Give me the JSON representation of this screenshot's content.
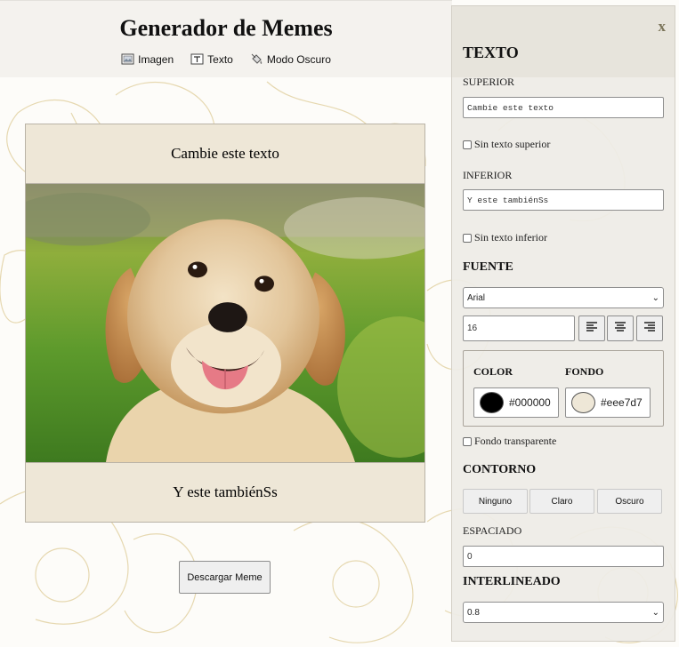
{
  "header": {
    "title": "Generador de Memes",
    "nav": [
      {
        "label": "Imagen",
        "icon": "image-icon"
      },
      {
        "label": "Texto",
        "icon": "text-icon"
      },
      {
        "label": "Modo Oscuro",
        "icon": "paint-bucket-icon"
      }
    ]
  },
  "meme": {
    "top_text": "Cambie este texto",
    "bottom_text": "Y este tambiénSs",
    "image": "golden-retriever-photo",
    "background_color": "#eee7d7",
    "text_color": "#000000"
  },
  "actions": {
    "download_label": "Descargar Meme"
  },
  "panel": {
    "close_label": "x",
    "text_section": "TEXTO",
    "top_label": "SUPERIOR",
    "top_value": "Cambie este texto",
    "no_top_label": "Sin texto superior",
    "bottom_label": "INFERIOR",
    "bottom_value": "Y este tambiénSs",
    "no_bottom_label": "Sin texto inferior",
    "font_section": "FUENTE",
    "font_family": "Arial",
    "font_size": "16",
    "color_label": "COLOR",
    "color_value": "#000000",
    "bg_label": "FONDO",
    "bg_value": "#eee7d7",
    "transparent_label": "Fondo transparente",
    "outline_section": "CONTORNO",
    "outline_options": [
      "Ninguno",
      "Claro",
      "Oscuro"
    ],
    "spacing_label": "ESPACIADO",
    "spacing_value": "0",
    "line_height_section": "INTERLINEADO",
    "line_height_value": "0.8"
  },
  "colors": {
    "accent_close": "#7b7459",
    "panel_bg": "#eeece6",
    "floral_line": "#e2d3a8"
  }
}
